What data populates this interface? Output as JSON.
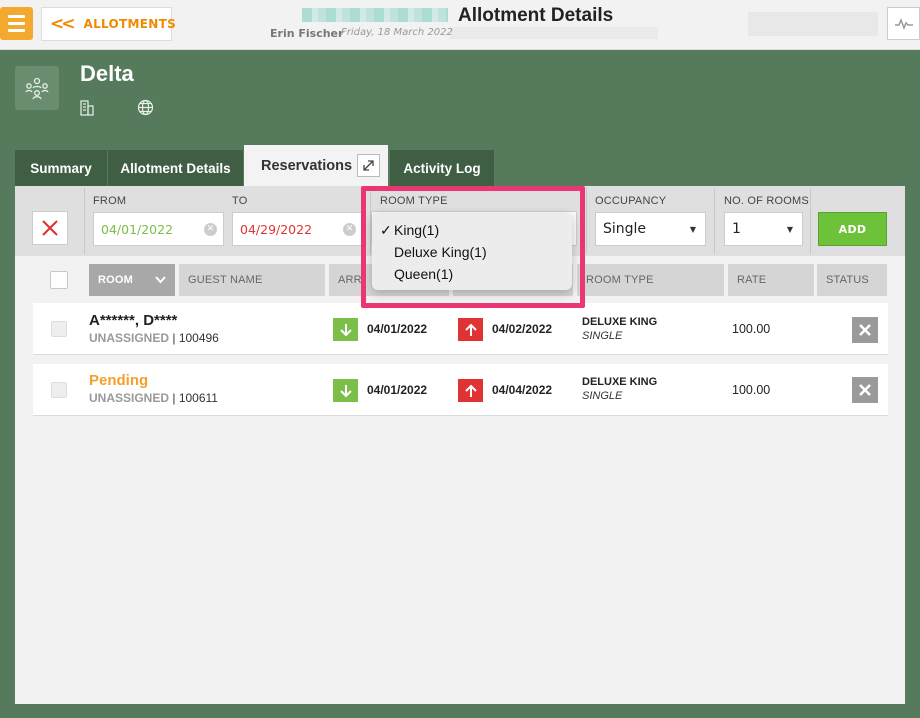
{
  "header": {
    "back_label": "ALLOTMENTS",
    "title": "Allotment Details",
    "user": "Erin Fischer",
    "date": "Friday, 18 March 2022"
  },
  "property": {
    "name": "Delta"
  },
  "tabs": [
    {
      "label": "Summary"
    },
    {
      "label": "Allotment Details"
    },
    {
      "label": "Reservations",
      "active": true
    },
    {
      "label": "Activity Log"
    }
  ],
  "filters": {
    "from_label": "FROM",
    "from_value": "04/01/2022",
    "to_label": "TO",
    "to_value": "04/29/2022",
    "room_type_label": "ROOM TYPE",
    "occupancy_label": "OCCUPANCY",
    "occupancy_value": "Single",
    "rooms_label": "NO. OF ROOMS",
    "rooms_value": "1",
    "add_label": "ADD"
  },
  "room_type_options": [
    {
      "label": "King(1)",
      "selected": true
    },
    {
      "label": "Deluxe King(1)",
      "selected": false
    },
    {
      "label": "Queen(1)",
      "selected": false
    }
  ],
  "columns": {
    "room": "ROOM",
    "guest_name": "GUEST NAME",
    "arrival": "ARRI",
    "room_type": "ROOM TYPE",
    "rate": "RATE",
    "status": "STATUS"
  },
  "reservations": [
    {
      "guest": "A******, D****",
      "room_status": "UNASSIGNED",
      "conf": "100496",
      "arrival": "04/01/2022",
      "departure": "04/02/2022",
      "room_type": "DELUXE KING",
      "occupancy": "SINGLE",
      "rate": "100.00"
    },
    {
      "guest": "Pending",
      "room_status": "UNASSIGNED",
      "conf": "100611",
      "arrival": "04/01/2022",
      "departure": "04/04/2022",
      "room_type": "DELUXE KING",
      "occupancy": "SINGLE",
      "rate": "100.00"
    }
  ],
  "colors": {
    "background": "#567b5c",
    "accent_orange": "#f3a92d",
    "add_green": "#6ec23a",
    "arrival_green": "#7cbe4a",
    "departure_red": "#e03434",
    "highlight_pink": "#ea3672"
  },
  "icons": {
    "menu": "menu-icon",
    "back": "double-chevron-left-icon",
    "activity": "pulse-icon",
    "property": "people-group-icon",
    "building": "building-icon",
    "globe": "globe-icon",
    "expand": "expand-icon",
    "clear": "close-icon",
    "arrival": "arrow-down-icon",
    "departure": "arrow-up-icon",
    "delete": "close-icon"
  }
}
